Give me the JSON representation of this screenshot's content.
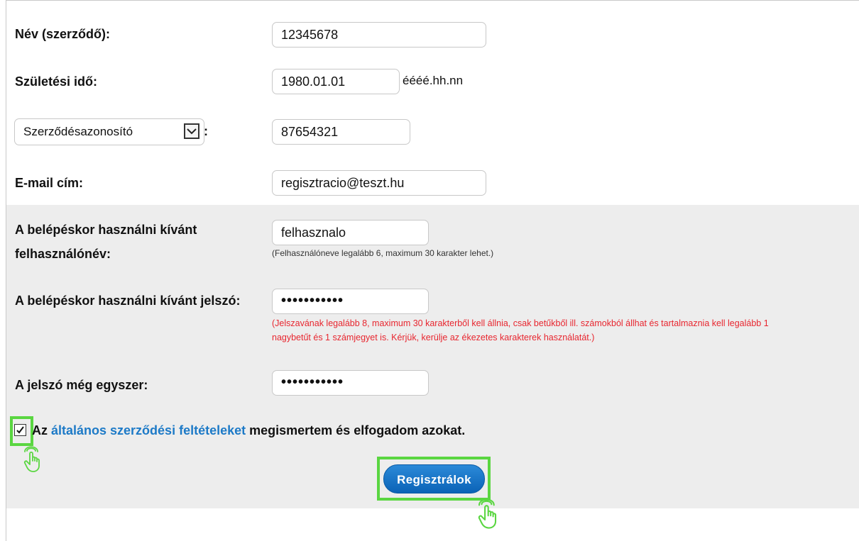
{
  "form": {
    "name_label": "Név (szerződő):",
    "name_value": "12345678",
    "birth_label": "Születési idő:",
    "birth_value": "1980.01.01",
    "birth_format": "éééé.hh.nn",
    "id_select_value": "Szerződésazonosító",
    "id_select_colon": ":",
    "id_value": "87654321",
    "email_label": "E-mail cím:",
    "email_value": "regisztracio@teszt.hu",
    "username_label_line1": "A belépéskor használni kívánt",
    "username_label_line2": "felhasználónév:",
    "username_value": "felhasznalo",
    "username_hint": "(Felhasználóneve legalább 6, maximum 30 karakter lehet.)",
    "password_label": "A belépéskor használni kívánt jelszó:",
    "password_value": "•••••••••••",
    "password_hint_line1": "(Jelszavának legalább 8, maximum 30 karakterből kell állnia, csak betűkből ill. számokból állhat és tartalmaznia kell legalább 1",
    "password_hint_line2": "nagybetűt és 1 számjegyet is. Kérjük, kerülje az ékezetes karakterek használatát.)",
    "password2_label": "A jelszó még egyszer:",
    "password2_value": "•••••••••••",
    "terms_prefix": "Az ",
    "terms_link": "általános szerződési feltételeket",
    "terms_suffix": " megismertem és elfogadom azokat.",
    "terms_checked": true,
    "submit_label": "Regisztrálok"
  },
  "colors": {
    "highlight": "#5ad641",
    "link": "#1d7ac7",
    "hint_red": "#e8262f",
    "button": "#0b63b7"
  },
  "icons": [
    "select-arrow-icon",
    "checkmark-icon",
    "pointer-hand-icon"
  ]
}
